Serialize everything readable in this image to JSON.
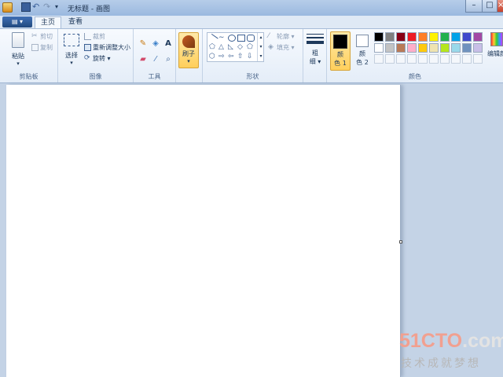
{
  "window": {
    "title": "无标题 - 画图",
    "quick_access_dropdown": "▾",
    "minimize": "–",
    "maximize": "□",
    "close": "×"
  },
  "menu_button": "▤ ▾",
  "tabs": [
    {
      "label": "主页",
      "active": true
    },
    {
      "label": "查看",
      "active": false
    }
  ],
  "clipboard": {
    "group_label": "剪贴板",
    "paste": "粘贴",
    "cut": "剪切",
    "copy": "复制"
  },
  "image": {
    "group_label": "图像",
    "select": "选择",
    "crop": "裁剪",
    "resize": "重新调整大小",
    "rotate": "旋转 ▾"
  },
  "tools": {
    "group_label": "工具",
    "text_tool": "A"
  },
  "brushes": {
    "label": "刷子"
  },
  "shapes": {
    "group_label": "形状",
    "outline": "轮廓 ▾",
    "fill": "填充 ▾"
  },
  "size": {
    "label_line1": "粗",
    "label_line2": "细 ▾"
  },
  "colors": {
    "group_label": "颜色",
    "color1_label_1": "颜",
    "color1_label_2": "色 1",
    "color2_label_1": "颜",
    "color2_label_2": "色 2",
    "edit_colors": "编辑颜",
    "color1": "#000000",
    "color2": "#ffffff",
    "palette_row1": [
      "#000000",
      "#7f7f7f",
      "#880015",
      "#ed1c24",
      "#ff7f27",
      "#fff200",
      "#22b14c",
      "#00a2e8",
      "#3f48cc",
      "#a349a4"
    ],
    "palette_row2": [
      "#ffffff",
      "#c3c3c3",
      "#b97a57",
      "#ffaec9",
      "#ffc90e",
      "#efe4b0",
      "#b5e61d",
      "#99d9ea",
      "#7092be",
      "#c8bfe7"
    ]
  },
  "watermark": {
    "main": "51CTO",
    "suffix": ".com",
    "sub": "技术成就梦想"
  }
}
